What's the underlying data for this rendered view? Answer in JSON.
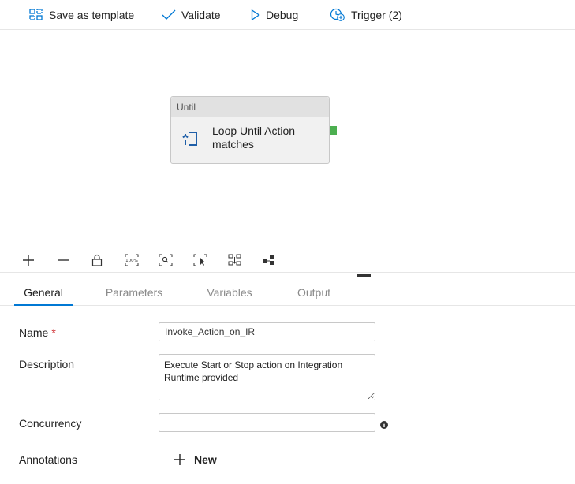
{
  "toolbar": {
    "save_as_template": "Save as template",
    "validate": "Validate",
    "debug": "Debug",
    "trigger": "Trigger (2)"
  },
  "canvas": {
    "activity": {
      "type": "Until",
      "name": "Loop Until Action matches",
      "icon": "until-loop-icon"
    }
  },
  "canvas_tools": [
    "plus-icon",
    "minus-icon",
    "lock-icon",
    "zoom-100-icon",
    "zoom-to-fit-icon",
    "select-icon",
    "auto-align-icon",
    "layout-icon"
  ],
  "tabs": [
    {
      "label": "General",
      "active": true
    },
    {
      "label": "Parameters",
      "active": false
    },
    {
      "label": "Variables",
      "active": false
    },
    {
      "label": "Output",
      "active": false
    }
  ],
  "form": {
    "name_label": "Name",
    "required_marker": "*",
    "name_value": "Invoke_Action_on_IR",
    "description_label": "Description",
    "description_value": "Execute Start or Stop action on Integration Runtime provided",
    "concurrency_label": "Concurrency",
    "concurrency_value": "",
    "annotations_label": "Annotations",
    "new_label": "New"
  },
  "colors": {
    "accent": "#0078d4",
    "success": "#4caf50",
    "required": "#d13438"
  }
}
